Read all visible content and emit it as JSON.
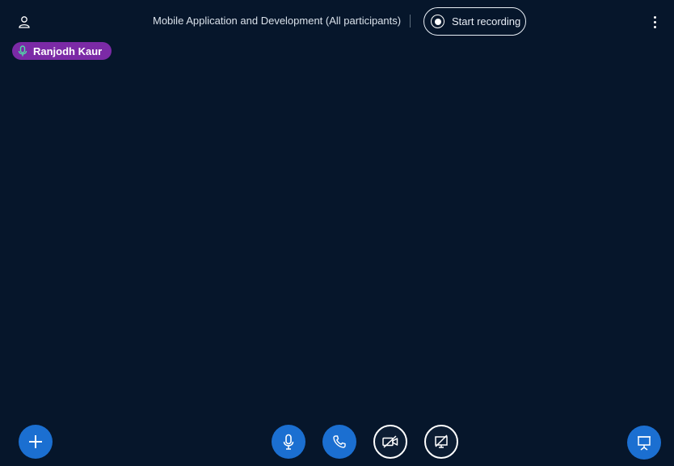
{
  "header": {
    "meeting_title": "Mobile Application and Development (All participants)",
    "record_label": "Start recording"
  },
  "talking_indicator": {
    "name": "Ranjodh Kaur",
    "color": "#7b2aa6"
  },
  "controls": {
    "actions": "plus-icon",
    "mic": "microphone-icon",
    "phone": "phone-icon",
    "video": "video-off-icon",
    "screenshare": "screenshare-off-icon",
    "presentation": "presentation-icon"
  },
  "colors": {
    "background": "#06162b",
    "primary_button": "#1b6fd1",
    "talker_badge": "#7b2aa6"
  }
}
